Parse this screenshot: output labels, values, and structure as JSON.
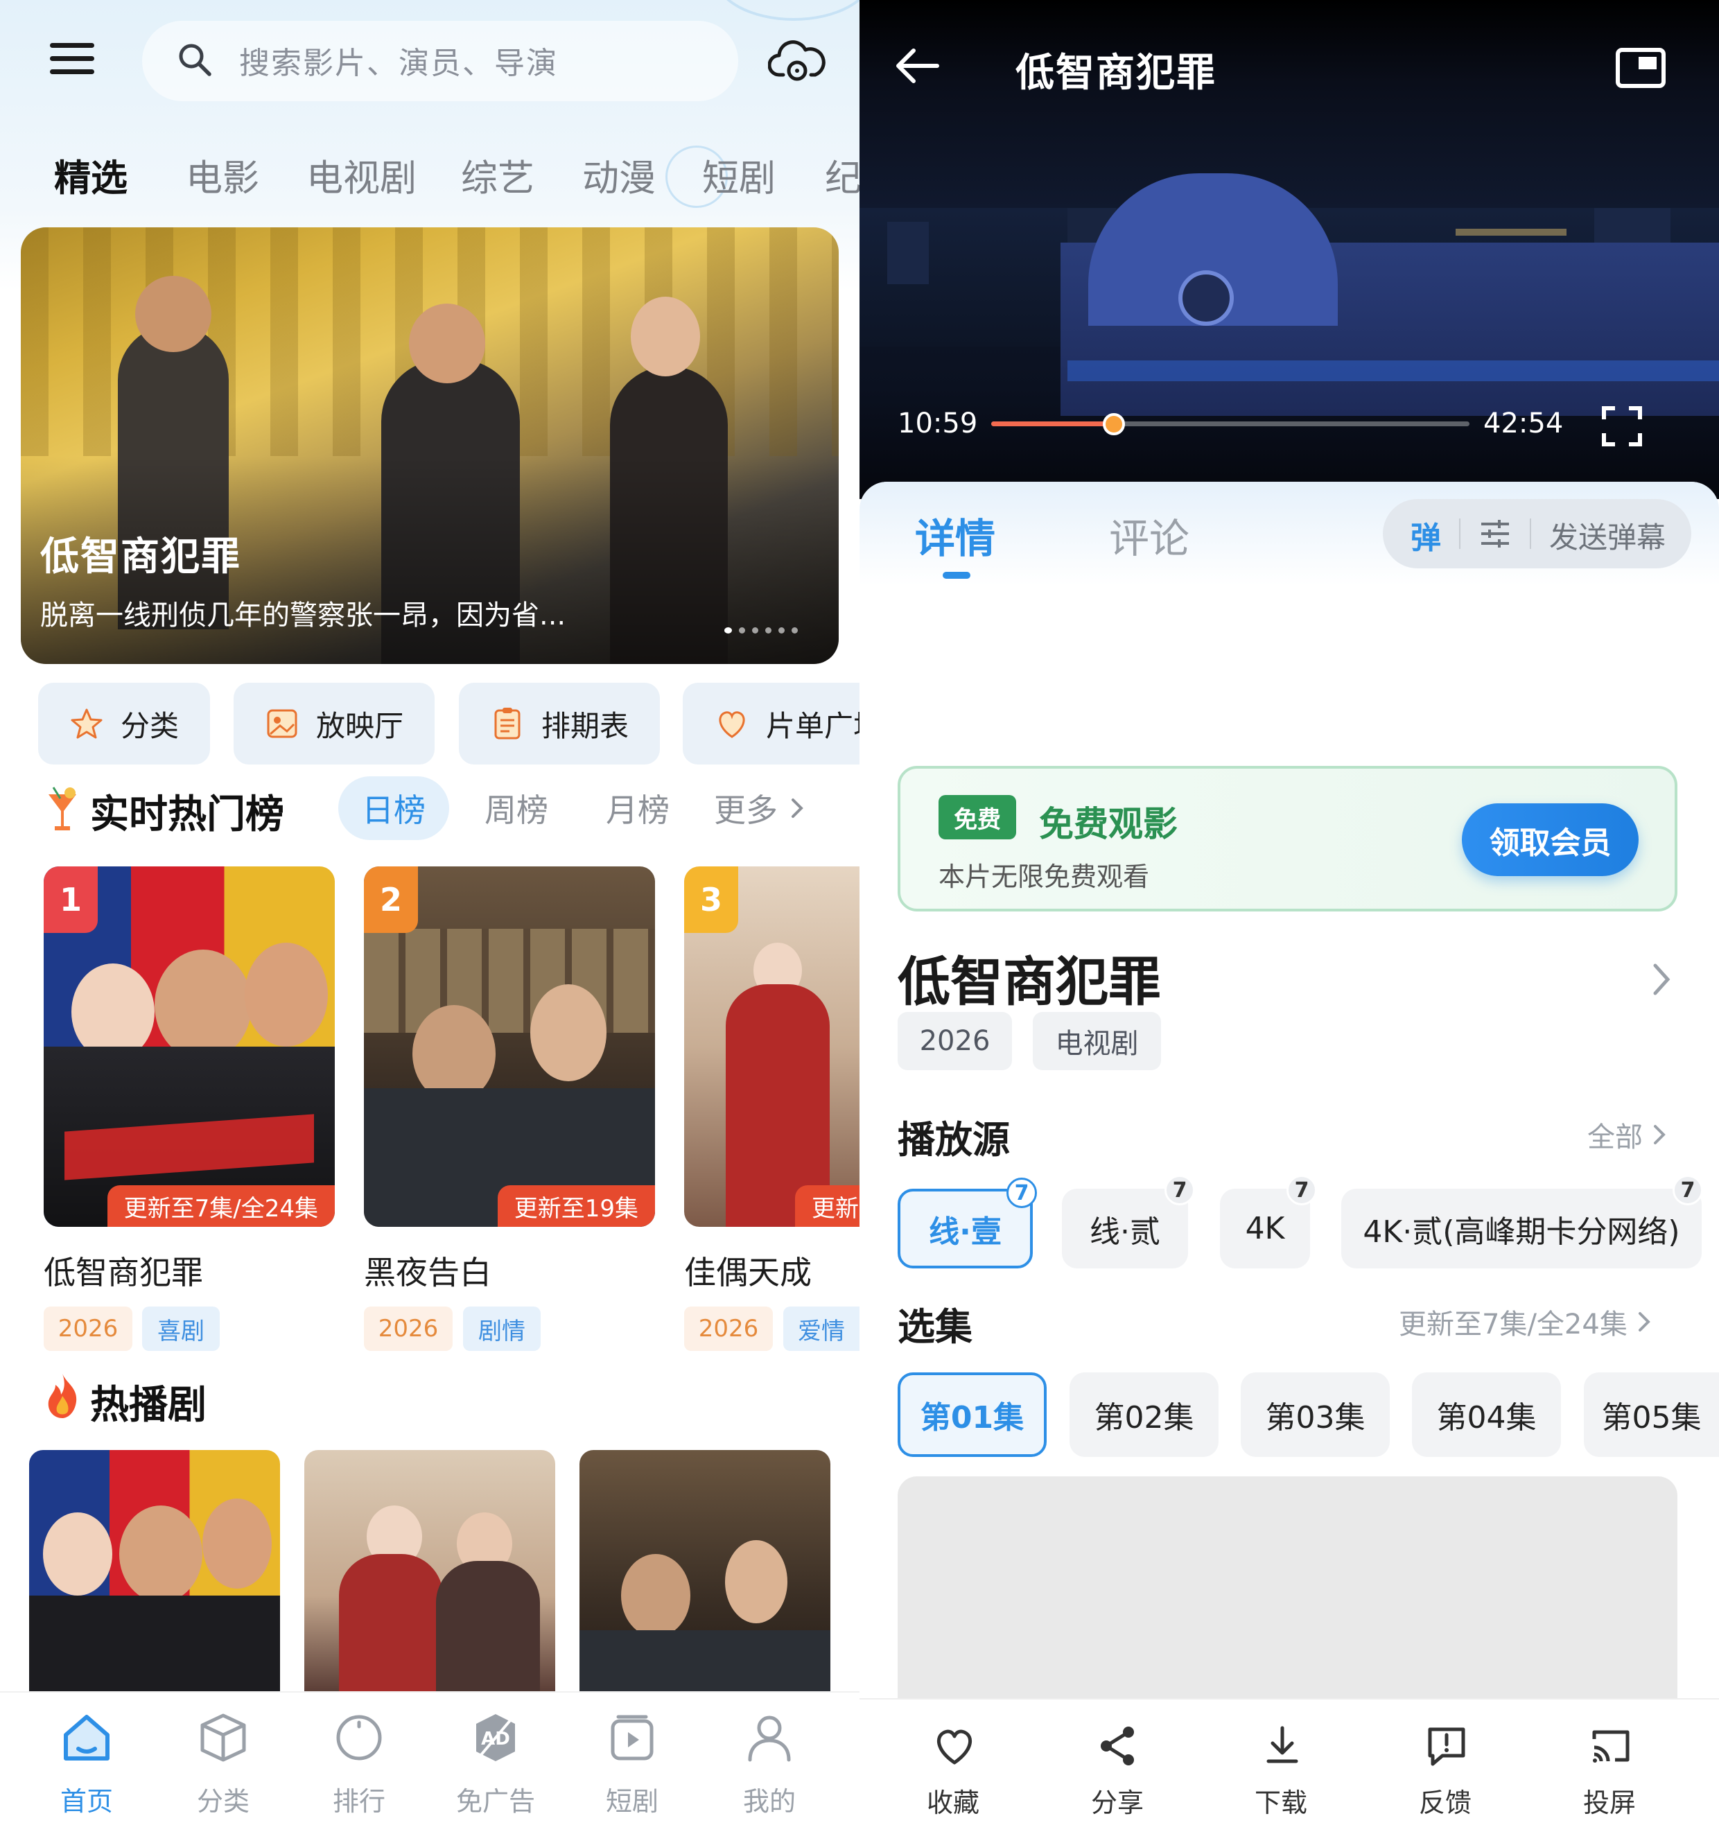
{
  "left": {
    "search": {
      "placeholder": "搜索影片、演员、导演",
      "icon": "search-icon"
    },
    "top_icons": {
      "menu": "menu-icon",
      "cloud": "cloud-icon"
    },
    "categories": [
      "精选",
      "电影",
      "电视剧",
      "综艺",
      "动漫",
      "短剧",
      "纪"
    ],
    "active_category": "精选",
    "banner": {
      "title": "低智商犯罪",
      "description": "脱离一线刑侦几年的警察张一昂，因为省...",
      "dots": 6,
      "active_dot": 0
    },
    "quick_links": [
      {
        "label": "分类",
        "icon": "star-icon"
      },
      {
        "label": "放映厅",
        "icon": "cinema-icon"
      },
      {
        "label": "排期表",
        "icon": "schedule-icon"
      },
      {
        "label": "片单广场",
        "icon": "heart-icon"
      }
    ],
    "hot_ranking": {
      "title": "实时热门榜",
      "tabs": [
        "日榜",
        "周榜",
        "月榜"
      ],
      "active_tab": "日榜",
      "more": "更多",
      "items": [
        {
          "rank": "1",
          "title": "低智商犯罪",
          "update": "更新至7集/全24集",
          "year": "2026",
          "genre": "喜剧",
          "badge_color": "#e9454a",
          "cover": [
            "#1e3a8a",
            "#d4202a",
            "#e9b72a"
          ]
        },
        {
          "rank": "2",
          "title": "黑夜告白",
          "update": "更新至19集",
          "year": "2026",
          "genre": "剧情",
          "badge_color": "#f08a2e",
          "cover": [
            "#5c4734",
            "#3b2f25",
            "#7a6548"
          ]
        },
        {
          "rank": "3",
          "title": "佳偶天成",
          "update": "更新至",
          "year": "2026",
          "genre": "爱情",
          "badge_color": "#f5b62e",
          "cover": [
            "#e6d5c2",
            "#b32a28",
            "#7d5a48"
          ]
        }
      ]
    },
    "hot_drama": {
      "title": "热播剧",
      "covers": [
        [
          "#1e3a8a",
          "#d4202a",
          "#e9b72a"
        ],
        [
          "#dccbb6",
          "#a62c2a",
          "#5a3d36"
        ],
        [
          "#5c4734",
          "#3b2f25",
          "#8a7556"
        ]
      ]
    },
    "tabbar": [
      {
        "label": "首页",
        "icon": "home-icon",
        "active": true
      },
      {
        "label": "分类",
        "icon": "cube-icon",
        "active": false
      },
      {
        "label": "排行",
        "icon": "ranking-icon",
        "active": false
      },
      {
        "label": "免广告",
        "icon": "ad-free-icon",
        "active": false
      },
      {
        "label": "短剧",
        "icon": "short-video-icon",
        "active": false
      },
      {
        "label": "我的",
        "icon": "profile-icon",
        "active": false
      }
    ],
    "accent": "#2d8fe6"
  },
  "right": {
    "player": {
      "title": "低智商犯罪",
      "current_time": "10:59",
      "total_time": "42:54",
      "progress": 0.256
    },
    "tabs": [
      "详情",
      "评论"
    ],
    "active_tab": "详情",
    "danmu": {
      "toggle": "弹",
      "send": "发送弹幕"
    },
    "promo": {
      "badge": "免费",
      "title": "免费观影",
      "subtitle": "本片无限免费观看",
      "button": "领取会员"
    },
    "show": {
      "title": "低智商犯罪",
      "year": "2026",
      "type": "电视剧"
    },
    "sources": {
      "title": "播放源",
      "more": "全部",
      "items": [
        {
          "label": "线·壹",
          "count": "7"
        },
        {
          "label": "线·贰",
          "count": "7"
        },
        {
          "label": "4K",
          "count": "7"
        },
        {
          "label": "4K·贰(高峰期卡分网络)",
          "count": "7"
        }
      ],
      "active": 0
    },
    "episodes": {
      "title": "选集",
      "status": "更新至7集/全24集",
      "items": [
        "第01集",
        "第02集",
        "第03集",
        "第04集",
        "第05集"
      ],
      "active": 0
    },
    "tabbar": [
      {
        "label": "收藏",
        "icon": "heart-outline-icon"
      },
      {
        "label": "分享",
        "icon": "share-icon"
      },
      {
        "label": "下载",
        "icon": "download-icon"
      },
      {
        "label": "反馈",
        "icon": "feedback-icon"
      },
      {
        "label": "投屏",
        "icon": "cast-icon"
      }
    ]
  }
}
